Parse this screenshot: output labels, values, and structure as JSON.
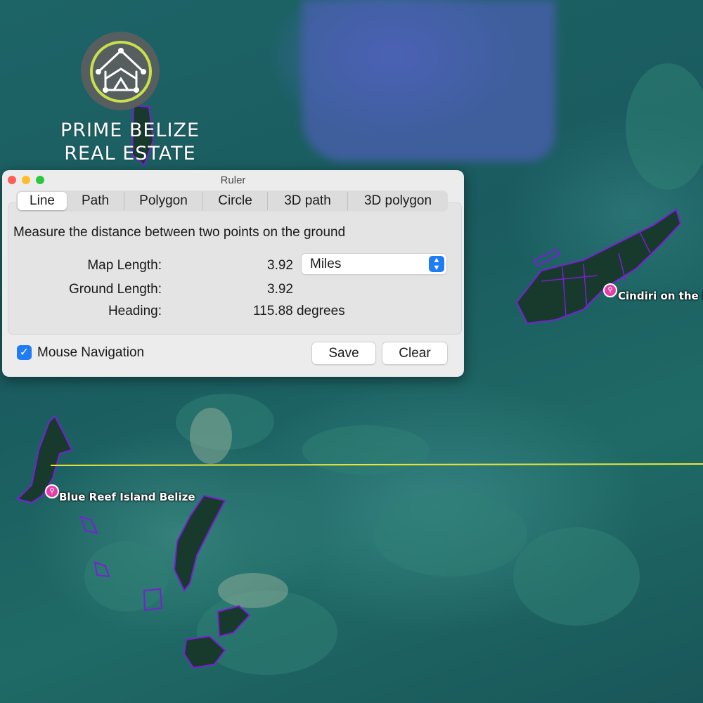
{
  "logo": {
    "line1": "PRIME BELIZE",
    "line2": "REAL ESTATE"
  },
  "map": {
    "labels": [
      {
        "text": "Cindiri on the R",
        "icon": "pin-icon"
      },
      {
        "text": "Blue Reef Island Belize",
        "icon": "pin-icon"
      }
    ],
    "colors": {
      "parcel_outline": "#7a1fd6",
      "ruler_line": "#e8e83a",
      "pin": "#e040a8"
    }
  },
  "window": {
    "title": "Ruler",
    "tabs": [
      "Line",
      "Path",
      "Polygon",
      "Circle",
      "3D path",
      "3D polygon"
    ],
    "active_tab": "Line",
    "description": "Measure the distance between two points on the ground",
    "map_length": {
      "label": "Map Length:",
      "value": "3.92"
    },
    "unit_select": {
      "value": "Miles"
    },
    "ground_length": {
      "label": "Ground Length:",
      "value": "3.92"
    },
    "heading": {
      "label": "Heading:",
      "value": "115.88 degrees"
    },
    "mouse_navigation": {
      "label": "Mouse Navigation",
      "checked": true
    },
    "save_label": "Save",
    "clear_label": "Clear"
  }
}
